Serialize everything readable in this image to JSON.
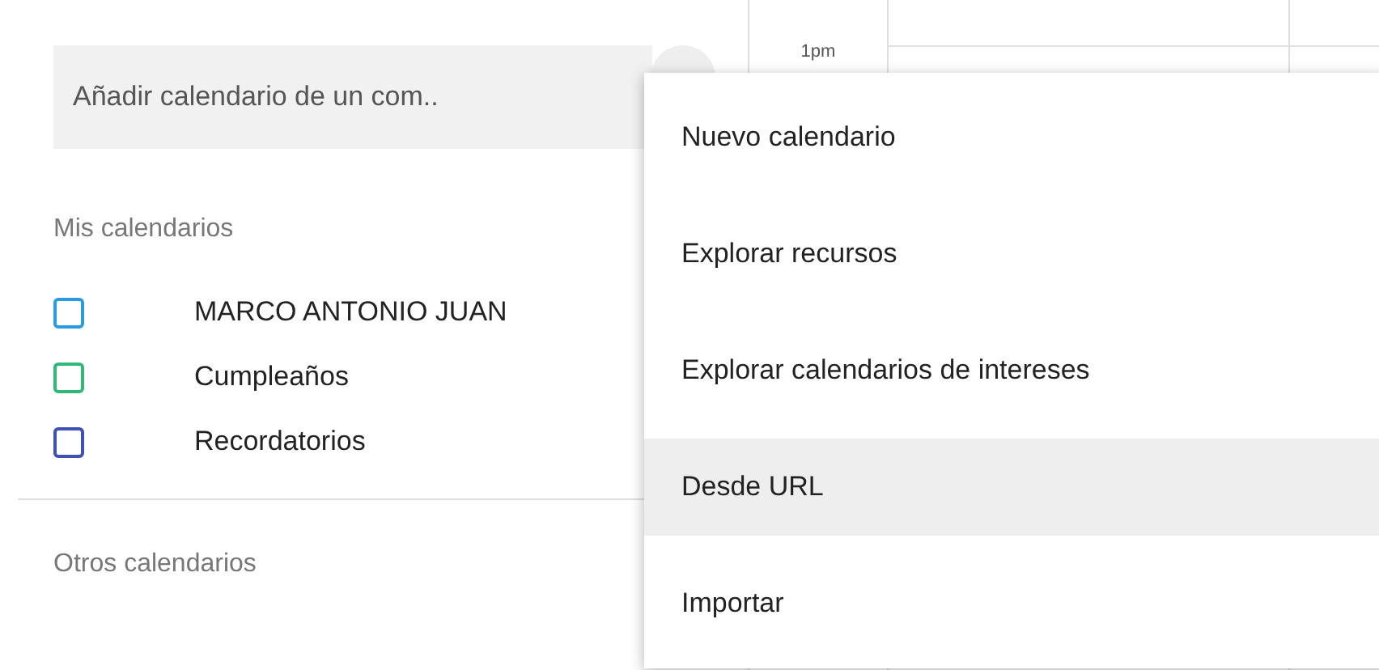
{
  "search": {
    "placeholder": "Añadir calendario de un com.."
  },
  "my_calendars": {
    "title": "Mis calendarios",
    "items": [
      {
        "label": "MARCO ANTONIO JUAN",
        "checked": false,
        "color": "#2a9be0"
      },
      {
        "label": "Cumpleaños",
        "checked": false,
        "color": "#33b679"
      },
      {
        "label": "Recordatorios",
        "checked": false,
        "color": "#3f51b5"
      }
    ]
  },
  "other_calendars": {
    "title": "Otros calendarios"
  },
  "time_grid": {
    "time_label": "1pm"
  },
  "menu": {
    "items": [
      {
        "label": "Nuevo calendario",
        "selected": false
      },
      {
        "label": "Explorar recursos",
        "selected": false
      },
      {
        "label": "Explorar calendarios de intereses",
        "selected": false
      },
      {
        "label": "Desde URL",
        "selected": true
      },
      {
        "label": "Importar",
        "selected": false
      }
    ]
  }
}
